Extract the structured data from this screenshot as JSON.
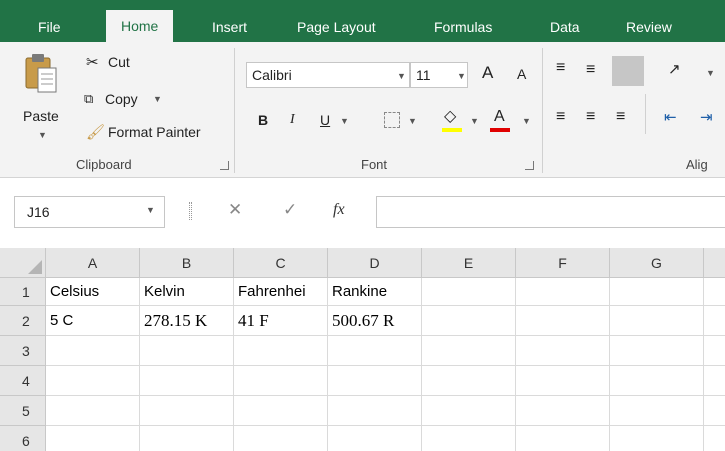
{
  "tabs": [
    "File",
    "Home",
    "Insert",
    "Page Layout",
    "Formulas",
    "Data",
    "Review"
  ],
  "clipboard": {
    "paste": "Paste",
    "cut": "Cut",
    "copy": "Copy",
    "format_painter": "Format Painter",
    "group_label": "Clipboard"
  },
  "font": {
    "name": "Calibri",
    "size": "11",
    "bold": "B",
    "italic": "I",
    "underline": "U",
    "grow": "A",
    "shrink": "A",
    "font_color": "A",
    "group_label": "Font"
  },
  "alignment": {
    "group_label_partial": "Alig"
  },
  "formula_bar": {
    "name_box": "J16",
    "cancel": "✕",
    "enter": "✓",
    "fx": "fx",
    "value": ""
  },
  "sheet": {
    "columns": [
      "A",
      "B",
      "C",
      "D",
      "E",
      "F",
      "G"
    ],
    "rows": [
      {
        "num": "1",
        "cells": [
          "Celsius",
          "Kelvin",
          "Fahrenhei",
          "Rankine",
          "",
          "",
          ""
        ]
      },
      {
        "num": "2",
        "cells": [
          "5 C",
          "278.15 K",
          "41 F",
          "500.67 R",
          "",
          "",
          ""
        ]
      },
      {
        "num": "3",
        "cells": [
          "",
          "",
          "",
          "",
          "",
          "",
          ""
        ]
      },
      {
        "num": "4",
        "cells": [
          "",
          "",
          "",
          "",
          "",
          "",
          ""
        ]
      },
      {
        "num": "5",
        "cells": [
          "",
          "",
          "",
          "",
          "",
          "",
          ""
        ]
      },
      {
        "num": "6",
        "cells": [
          "",
          "",
          "",
          "",
          "",
          "",
          ""
        ]
      }
    ]
  },
  "colors": {
    "accent": "#217346",
    "ribbon_bg": "#f3f3f3",
    "font_color_bar": "#e00000",
    "highlight_bar": "#ffff00"
  }
}
